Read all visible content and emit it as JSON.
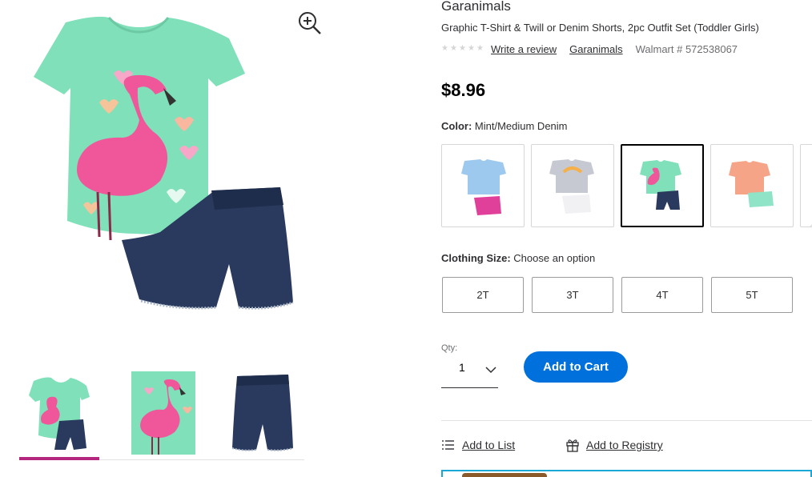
{
  "product": {
    "brand": "Garanimals",
    "name": "Graphic T-Shirt & Twill or Denim Shorts, 2pc Outfit Set (Toddler Girls)",
    "rating_stars": 0,
    "write_review": "Write a review",
    "brand_link": "Garanimals",
    "item_number": "Walmart # 572538067",
    "price": "$8.96"
  },
  "gallery": {
    "zoom_icon": "zoom-in-icon",
    "thumbnails": [
      "outfit-set",
      "flamingo-shirt-closeup",
      "denim-shorts"
    ],
    "selected_index": 0,
    "selected_color": "#b5277e"
  },
  "color": {
    "label": "Color:",
    "value": "Mint/Medium Denim",
    "swatches": [
      "blue-tee-pink-shorts",
      "gray-tee-white-shorts",
      "mint-tee-denim-shorts",
      "coral-tee-mint-shorts",
      "more"
    ],
    "selected_index": 2
  },
  "size": {
    "label": "Clothing Size:",
    "value": "Choose an option",
    "options": [
      "2T",
      "3T",
      "4T",
      "5T"
    ]
  },
  "quantity": {
    "label": "Qty:",
    "value": "1"
  },
  "cart": {
    "add_label": "Add to Cart",
    "accent": "#0071dc"
  },
  "actions": {
    "add_to_list": "Add to List",
    "add_to_registry": "Add to Registry"
  }
}
